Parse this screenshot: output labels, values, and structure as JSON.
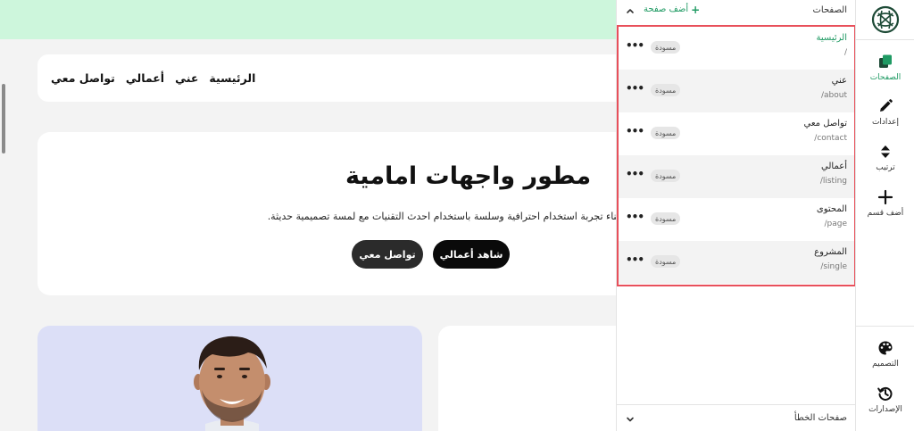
{
  "preview": {
    "nav_links": [
      "الرئيسية",
      "عني",
      "أعمالي",
      "تواصل معي"
    ],
    "hero_title": "مطور واجهات امامية",
    "hero_subtitle": "ساعدك في بناء تجربة استخدام احترافية وسلسة باستخدام احدث التقنيات مع لمسة تصميمية حديثة.",
    "primary_button": "شاهد أعمالي",
    "secondary_button": "تواصل معي"
  },
  "panel": {
    "title": "الصفحات",
    "add_page": "أضف صفحة",
    "draft_badge": "مسودة",
    "pages": [
      {
        "name": "الرئيسية",
        "path": "/",
        "active": true
      },
      {
        "name": "عني",
        "path": "/about",
        "active": false
      },
      {
        "name": "تواصل معي",
        "path": "/contact",
        "active": false
      },
      {
        "name": "أعمالي",
        "path": "/listing",
        "active": false
      },
      {
        "name": "المحتوى",
        "path": "/page",
        "active": false
      },
      {
        "name": "المشروع",
        "path": "/single",
        "active": false
      }
    ],
    "error_pages": "صفحات الخطأ"
  },
  "rail": {
    "pages": "الصفحات",
    "settings": "إعدادات",
    "order": "ترتيب",
    "add_section": "أضف قسم",
    "design": "التصميم",
    "versions": "الإصدارات"
  },
  "colors": {
    "accent": "#1f9a63",
    "highlight_border": "#e8505b",
    "top_band": "#cdf6dc",
    "photo_card": "#dcdff7"
  }
}
